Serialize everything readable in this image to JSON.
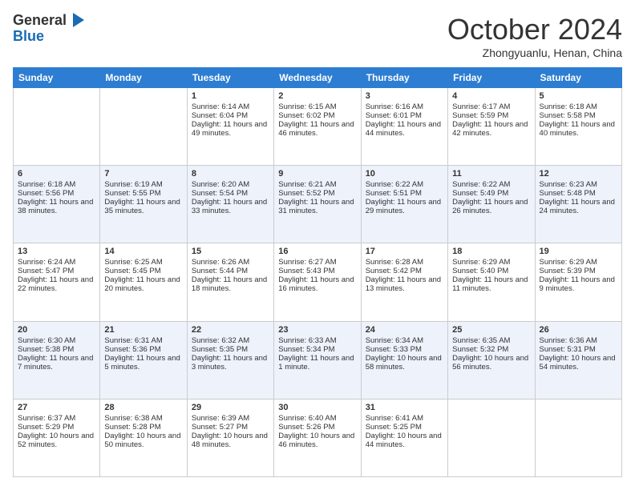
{
  "header": {
    "logo_line1": "General",
    "logo_line2": "Blue",
    "month_title": "October 2024",
    "location": "Zhongyuanlu, Henan, China"
  },
  "days_of_week": [
    "Sunday",
    "Monday",
    "Tuesday",
    "Wednesday",
    "Thursday",
    "Friday",
    "Saturday"
  ],
  "weeks": [
    [
      {
        "day": "",
        "sunrise": "",
        "sunset": "",
        "daylight": ""
      },
      {
        "day": "",
        "sunrise": "",
        "sunset": "",
        "daylight": ""
      },
      {
        "day": "1",
        "sunrise": "Sunrise: 6:14 AM",
        "sunset": "Sunset: 6:04 PM",
        "daylight": "Daylight: 11 hours and 49 minutes."
      },
      {
        "day": "2",
        "sunrise": "Sunrise: 6:15 AM",
        "sunset": "Sunset: 6:02 PM",
        "daylight": "Daylight: 11 hours and 46 minutes."
      },
      {
        "day": "3",
        "sunrise": "Sunrise: 6:16 AM",
        "sunset": "Sunset: 6:01 PM",
        "daylight": "Daylight: 11 hours and 44 minutes."
      },
      {
        "day": "4",
        "sunrise": "Sunrise: 6:17 AM",
        "sunset": "Sunset: 5:59 PM",
        "daylight": "Daylight: 11 hours and 42 minutes."
      },
      {
        "day": "5",
        "sunrise": "Sunrise: 6:18 AM",
        "sunset": "Sunset: 5:58 PM",
        "daylight": "Daylight: 11 hours and 40 minutes."
      }
    ],
    [
      {
        "day": "6",
        "sunrise": "Sunrise: 6:18 AM",
        "sunset": "Sunset: 5:56 PM",
        "daylight": "Daylight: 11 hours and 38 minutes."
      },
      {
        "day": "7",
        "sunrise": "Sunrise: 6:19 AM",
        "sunset": "Sunset: 5:55 PM",
        "daylight": "Daylight: 11 hours and 35 minutes."
      },
      {
        "day": "8",
        "sunrise": "Sunrise: 6:20 AM",
        "sunset": "Sunset: 5:54 PM",
        "daylight": "Daylight: 11 hours and 33 minutes."
      },
      {
        "day": "9",
        "sunrise": "Sunrise: 6:21 AM",
        "sunset": "Sunset: 5:52 PM",
        "daylight": "Daylight: 11 hours and 31 minutes."
      },
      {
        "day": "10",
        "sunrise": "Sunrise: 6:22 AM",
        "sunset": "Sunset: 5:51 PM",
        "daylight": "Daylight: 11 hours and 29 minutes."
      },
      {
        "day": "11",
        "sunrise": "Sunrise: 6:22 AM",
        "sunset": "Sunset: 5:49 PM",
        "daylight": "Daylight: 11 hours and 26 minutes."
      },
      {
        "day": "12",
        "sunrise": "Sunrise: 6:23 AM",
        "sunset": "Sunset: 5:48 PM",
        "daylight": "Daylight: 11 hours and 24 minutes."
      }
    ],
    [
      {
        "day": "13",
        "sunrise": "Sunrise: 6:24 AM",
        "sunset": "Sunset: 5:47 PM",
        "daylight": "Daylight: 11 hours and 22 minutes."
      },
      {
        "day": "14",
        "sunrise": "Sunrise: 6:25 AM",
        "sunset": "Sunset: 5:45 PM",
        "daylight": "Daylight: 11 hours and 20 minutes."
      },
      {
        "day": "15",
        "sunrise": "Sunrise: 6:26 AM",
        "sunset": "Sunset: 5:44 PM",
        "daylight": "Daylight: 11 hours and 18 minutes."
      },
      {
        "day": "16",
        "sunrise": "Sunrise: 6:27 AM",
        "sunset": "Sunset: 5:43 PM",
        "daylight": "Daylight: 11 hours and 16 minutes."
      },
      {
        "day": "17",
        "sunrise": "Sunrise: 6:28 AM",
        "sunset": "Sunset: 5:42 PM",
        "daylight": "Daylight: 11 hours and 13 minutes."
      },
      {
        "day": "18",
        "sunrise": "Sunrise: 6:29 AM",
        "sunset": "Sunset: 5:40 PM",
        "daylight": "Daylight: 11 hours and 11 minutes."
      },
      {
        "day": "19",
        "sunrise": "Sunrise: 6:29 AM",
        "sunset": "Sunset: 5:39 PM",
        "daylight": "Daylight: 11 hours and 9 minutes."
      }
    ],
    [
      {
        "day": "20",
        "sunrise": "Sunrise: 6:30 AM",
        "sunset": "Sunset: 5:38 PM",
        "daylight": "Daylight: 11 hours and 7 minutes."
      },
      {
        "day": "21",
        "sunrise": "Sunrise: 6:31 AM",
        "sunset": "Sunset: 5:36 PM",
        "daylight": "Daylight: 11 hours and 5 minutes."
      },
      {
        "day": "22",
        "sunrise": "Sunrise: 6:32 AM",
        "sunset": "Sunset: 5:35 PM",
        "daylight": "Daylight: 11 hours and 3 minutes."
      },
      {
        "day": "23",
        "sunrise": "Sunrise: 6:33 AM",
        "sunset": "Sunset: 5:34 PM",
        "daylight": "Daylight: 11 hours and 1 minute."
      },
      {
        "day": "24",
        "sunrise": "Sunrise: 6:34 AM",
        "sunset": "Sunset: 5:33 PM",
        "daylight": "Daylight: 10 hours and 58 minutes."
      },
      {
        "day": "25",
        "sunrise": "Sunrise: 6:35 AM",
        "sunset": "Sunset: 5:32 PM",
        "daylight": "Daylight: 10 hours and 56 minutes."
      },
      {
        "day": "26",
        "sunrise": "Sunrise: 6:36 AM",
        "sunset": "Sunset: 5:31 PM",
        "daylight": "Daylight: 10 hours and 54 minutes."
      }
    ],
    [
      {
        "day": "27",
        "sunrise": "Sunrise: 6:37 AM",
        "sunset": "Sunset: 5:29 PM",
        "daylight": "Daylight: 10 hours and 52 minutes."
      },
      {
        "day": "28",
        "sunrise": "Sunrise: 6:38 AM",
        "sunset": "Sunset: 5:28 PM",
        "daylight": "Daylight: 10 hours and 50 minutes."
      },
      {
        "day": "29",
        "sunrise": "Sunrise: 6:39 AM",
        "sunset": "Sunset: 5:27 PM",
        "daylight": "Daylight: 10 hours and 48 minutes."
      },
      {
        "day": "30",
        "sunrise": "Sunrise: 6:40 AM",
        "sunset": "Sunset: 5:26 PM",
        "daylight": "Daylight: 10 hours and 46 minutes."
      },
      {
        "day": "31",
        "sunrise": "Sunrise: 6:41 AM",
        "sunset": "Sunset: 5:25 PM",
        "daylight": "Daylight: 10 hours and 44 minutes."
      },
      {
        "day": "",
        "sunrise": "",
        "sunset": "",
        "daylight": ""
      },
      {
        "day": "",
        "sunrise": "",
        "sunset": "",
        "daylight": ""
      }
    ]
  ]
}
